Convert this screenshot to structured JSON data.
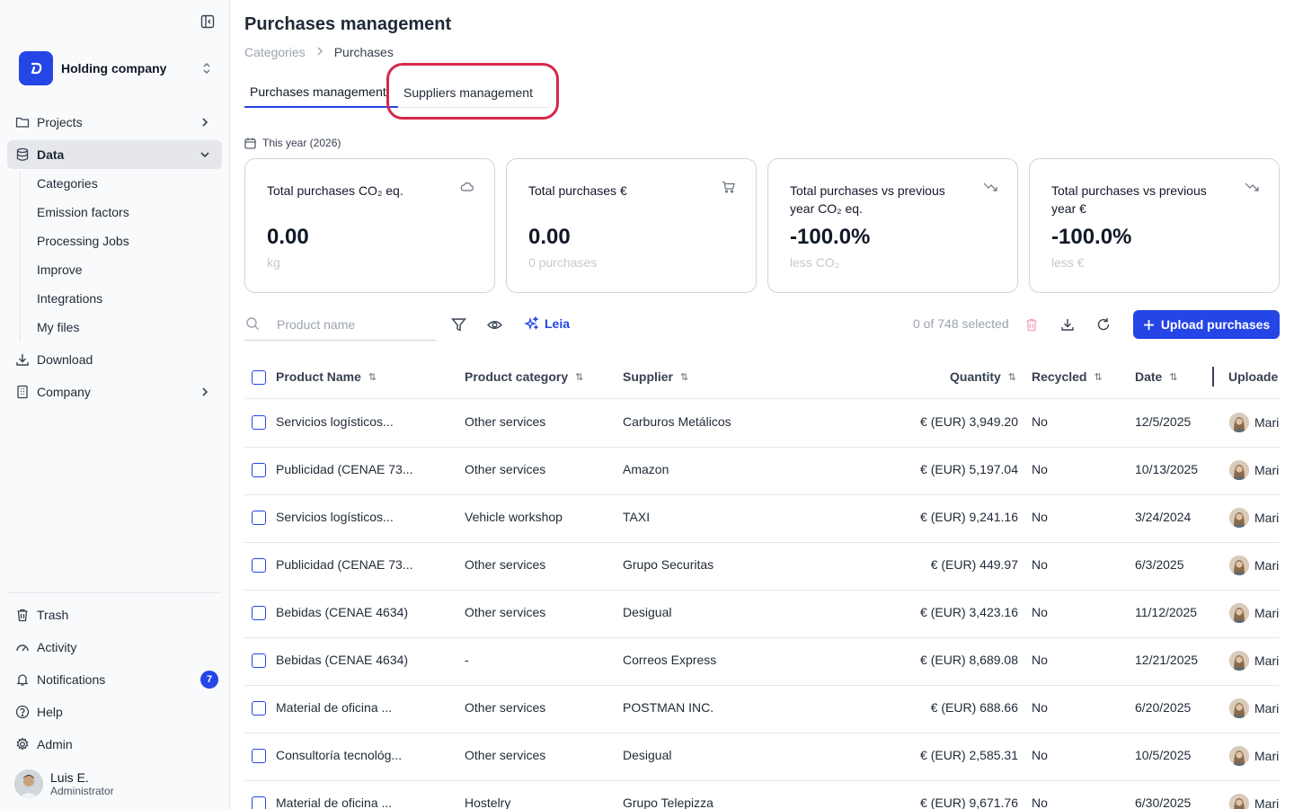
{
  "sidebar": {
    "company_name": "Holding company",
    "items": [
      {
        "label": "Projects",
        "icon": "folder-icon"
      },
      {
        "label": "Data",
        "icon": "database-icon"
      },
      {
        "label": "Download",
        "icon": "download-icon"
      },
      {
        "label": "Company",
        "icon": "building-icon"
      }
    ],
    "sub_items": [
      "Categories",
      "Emission factors",
      "Processing Jobs",
      "Improve",
      "Integrations",
      "My files"
    ],
    "bottom_items": [
      {
        "label": "Trash",
        "icon": "trash-icon"
      },
      {
        "label": "Activity",
        "icon": "activity-icon"
      },
      {
        "label": "Notifications",
        "icon": "bell-icon",
        "badge": "7"
      },
      {
        "label": "Help",
        "icon": "help-icon"
      },
      {
        "label": "Admin",
        "icon": "gear-icon"
      }
    ],
    "user": {
      "name": "Luis E.",
      "role": "Administrator"
    }
  },
  "header": {
    "title": "Purchases management",
    "breadcrumb": [
      "Categories",
      "Purchases"
    ],
    "tabs": [
      "Purchases management",
      "Suppliers management"
    ],
    "period": "This year (2026)"
  },
  "cards": [
    {
      "title": "Total purchases CO₂ eq.",
      "value": "0.00",
      "sub": "kg",
      "icon": "cloud-icon"
    },
    {
      "title": "Total purchases €",
      "value": "0.00",
      "sub": "0 purchases",
      "icon": "cart-icon"
    },
    {
      "title": "Total purchases vs previous year CO₂ eq.",
      "value": "-100.0%",
      "sub": "less CO₂",
      "icon": "trend-down-icon"
    },
    {
      "title": "Total purchases vs previous year €",
      "value": "-100.0%",
      "sub": "less €",
      "icon": "trend-down-icon"
    }
  ],
  "toolbar": {
    "search_placeholder": "Product name",
    "leia_label": "Leia",
    "selected_text": "0 of 748 selected",
    "upload_label": "Upload purchases"
  },
  "table": {
    "columns": [
      "Product Name",
      "Product category",
      "Supplier",
      "Quantity",
      "Recycled",
      "Date",
      "Uploade"
    ],
    "rows": [
      {
        "name": "Servicios logísticos...",
        "category": "Other services",
        "supplier": "Carburos Metálicos",
        "quantity": "€ (EUR) 3,949.20",
        "recycled": "No",
        "date": "12/5/2025",
        "uploader": "Mari"
      },
      {
        "name": "Publicidad (CENAE 73...",
        "category": "Other services",
        "supplier": "Amazon",
        "quantity": "€ (EUR) 5,197.04",
        "recycled": "No",
        "date": "10/13/2025",
        "uploader": "Mari"
      },
      {
        "name": "Servicios logísticos...",
        "category": "Vehicle workshop",
        "supplier": "TAXI",
        "quantity": "€ (EUR) 9,241.16",
        "recycled": "No",
        "date": "3/24/2024",
        "uploader": "Mari"
      },
      {
        "name": "Publicidad (CENAE 73...",
        "category": "Other services",
        "supplier": "Grupo Securitas",
        "quantity": "€ (EUR) 449.97",
        "recycled": "No",
        "date": "6/3/2025",
        "uploader": "Mari"
      },
      {
        "name": "Bebidas (CENAE 4634)",
        "category": "Other services",
        "supplier": "Desigual",
        "quantity": "€ (EUR) 3,423.16",
        "recycled": "No",
        "date": "11/12/2025",
        "uploader": "Mari"
      },
      {
        "name": "Bebidas (CENAE 4634)",
        "category": "-",
        "supplier": "Correos Express",
        "quantity": "€ (EUR) 8,689.08",
        "recycled": "No",
        "date": "12/21/2025",
        "uploader": "Mari"
      },
      {
        "name": "Material de oficina ...",
        "category": "Other services",
        "supplier": "POSTMAN INC.",
        "quantity": "€ (EUR) 688.66",
        "recycled": "No",
        "date": "6/20/2025",
        "uploader": "Mari"
      },
      {
        "name": "Consultoría tecnológ...",
        "category": "Other services",
        "supplier": "Desigual",
        "quantity": "€ (EUR) 2,585.31",
        "recycled": "No",
        "date": "10/5/2025",
        "uploader": "Mari"
      },
      {
        "name": "Material de oficina ...",
        "category": "Hostelry",
        "supplier": "Grupo Telepizza",
        "quantity": "€ (EUR) 9,671.76",
        "recycled": "No",
        "date": "6/30/2025",
        "uploader": "Mari"
      }
    ]
  },
  "colors": {
    "accent": "#2545e6",
    "highlight": "#d6284b",
    "sidebar_bg": "#f9fafb"
  }
}
